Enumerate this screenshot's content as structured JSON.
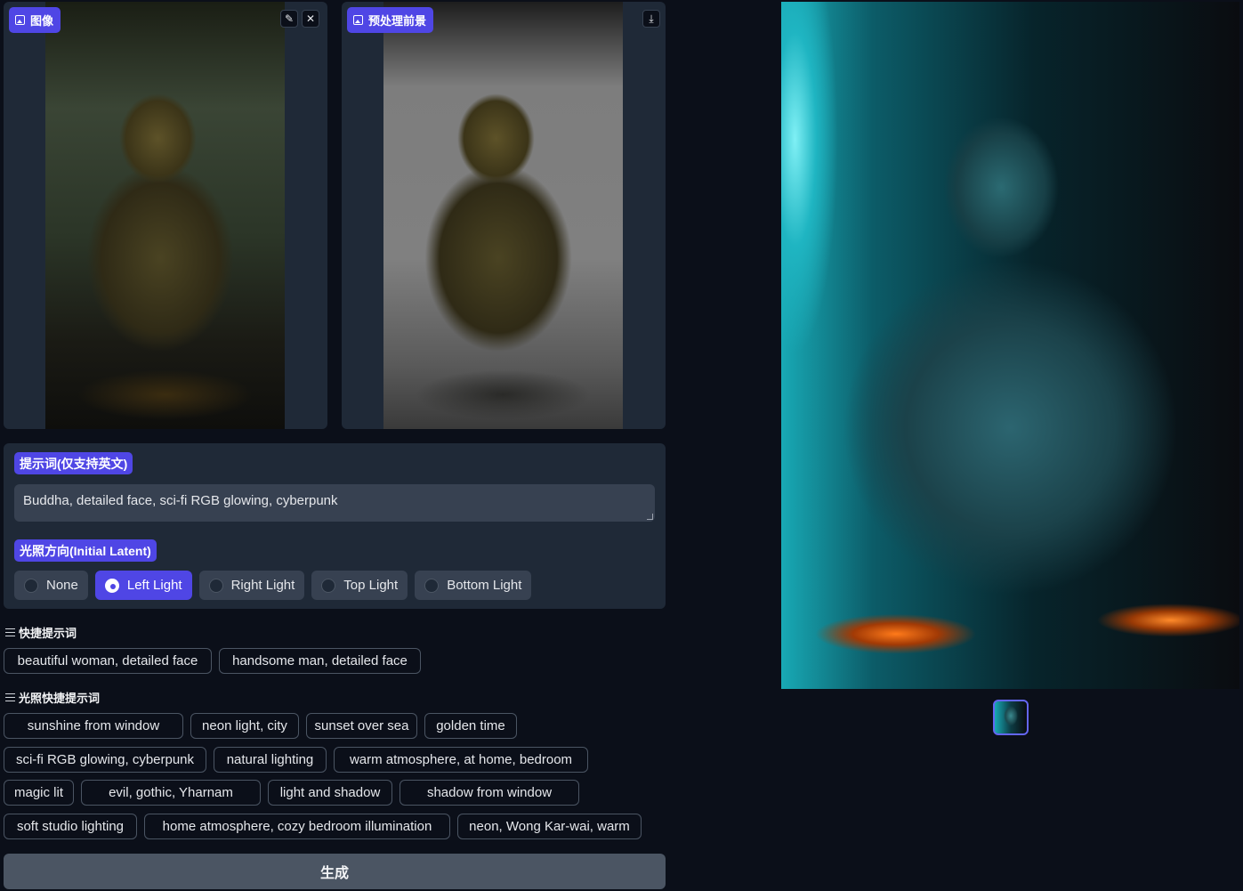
{
  "panels": {
    "input_label": "图像",
    "preprocess_label": "预处理前景"
  },
  "prompt": {
    "label": "提示词(仅支持英文)",
    "value": "Buddha, detailed face, sci-fi RGB glowing, cyberpunk"
  },
  "lighting": {
    "label": "光照方向(Initial Latent)",
    "options": [
      "None",
      "Left Light",
      "Right Light",
      "Top Light",
      "Bottom Light"
    ],
    "selected": "Left Light"
  },
  "quick_prompts": {
    "title": "快捷提示词",
    "items": [
      "beautiful woman, detailed face",
      "handsome man, detailed face"
    ]
  },
  "lighting_quick_prompts": {
    "title": "光照快捷提示词",
    "items": [
      "sunshine from window",
      "neon light, city",
      "sunset over sea",
      "golden time",
      "sci-fi RGB glowing, cyberpunk",
      "natural lighting",
      "warm atmosphere, at home, bedroom",
      "magic lit",
      "evil, gothic, Yharnam",
      "light and shadow",
      "shadow from window",
      "soft studio lighting",
      "home atmosphere, cozy bedroom illumination",
      "neon, Wong Kar-wai, warm"
    ]
  },
  "generate_label": "生成",
  "icons": {
    "edit": "pencil-icon",
    "close": "close-icon",
    "download": "download-icon",
    "image": "image-icon",
    "list": "list-icon"
  },
  "colors": {
    "accent": "#4f46e5",
    "background": "#0b0f19",
    "panel": "#1f2937"
  }
}
